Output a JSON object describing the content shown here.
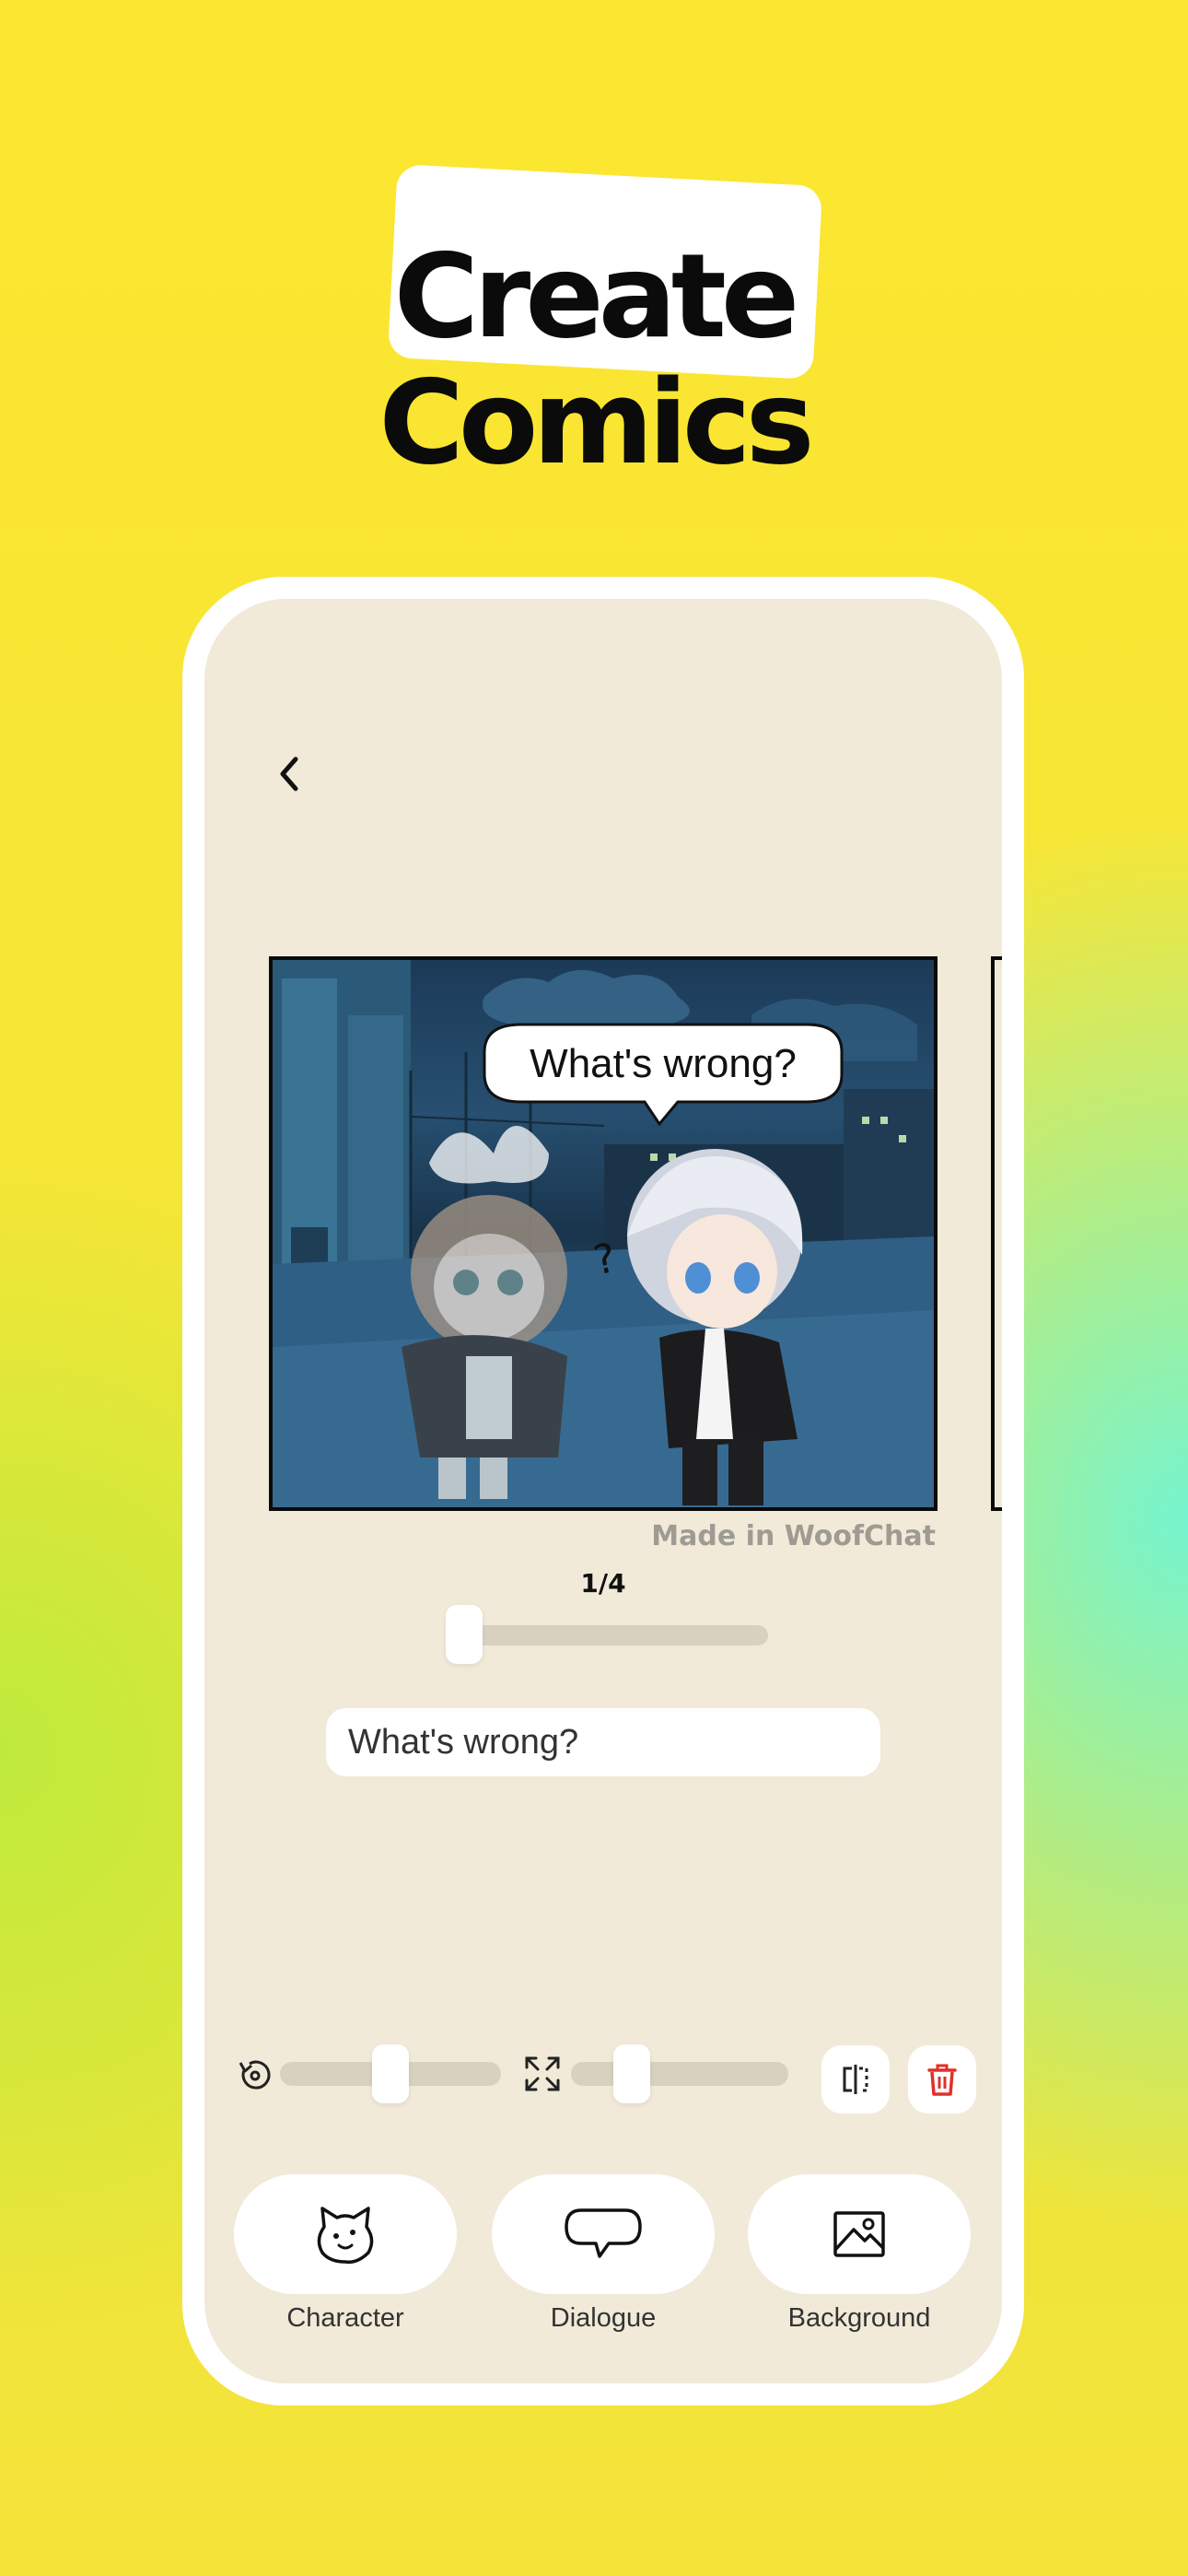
{
  "headline": {
    "line1": "Create",
    "line2": "Comics"
  },
  "comic": {
    "speech_bubble": "What's wrong?",
    "question_mark": "?",
    "watermark": "Made in WoofChat",
    "page_counter": "1/4",
    "page_position": 0.0
  },
  "editor": {
    "dialogue_value": "What's wrong?",
    "rotation_level": 0.5,
    "scale_level": 0.27
  },
  "tools": [
    {
      "label": "Character",
      "icon": "dog-face-icon"
    },
    {
      "label": "Dialogue",
      "icon": "speech-bubble-icon"
    },
    {
      "label": "Background",
      "icon": "image-icon"
    }
  ],
  "colors": {
    "delete": "#e0302a",
    "accent_yellow": "#fce62f",
    "screen_bg": "#f1ead8"
  }
}
